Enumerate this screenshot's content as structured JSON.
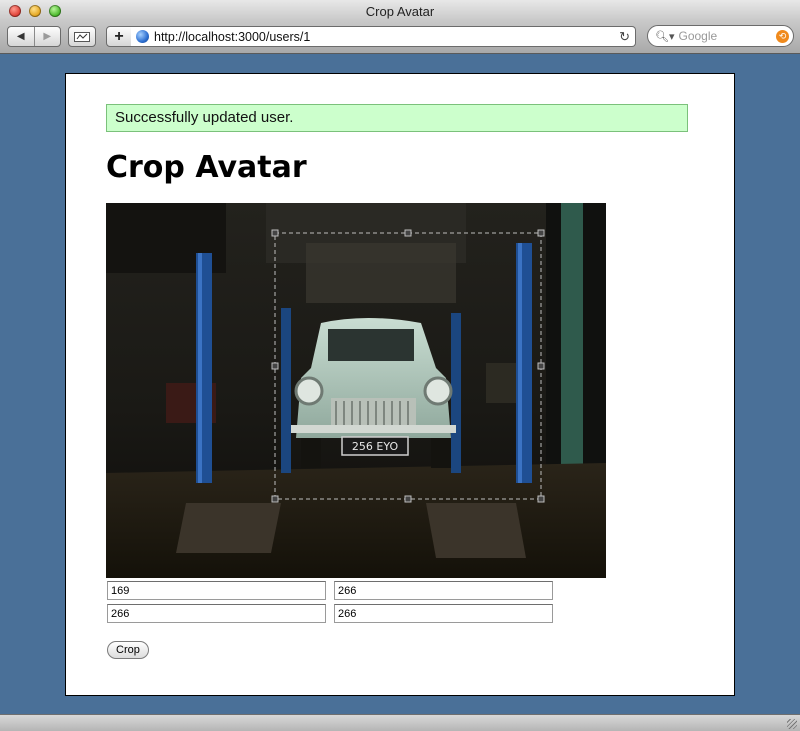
{
  "window": {
    "title": "Crop Avatar"
  },
  "toolbar": {
    "back_icon": "back-arrow-icon",
    "forward_icon": "forward-arrow-icon",
    "url": "http://localhost:3000/users/1",
    "search_placeholder": "Google"
  },
  "page": {
    "flash": "Successfully updated user.",
    "title": "Crop Avatar",
    "photo": {
      "plate": "256 EYO"
    },
    "fields": {
      "crop_x": "169",
      "crop_y": "266",
      "crop_w": "266",
      "crop_h": "266"
    },
    "crop_button": "Crop"
  },
  "colors": {
    "background": "#4a7098",
    "flash_bg": "#ccffcc",
    "flash_border": "#7bc17b"
  }
}
